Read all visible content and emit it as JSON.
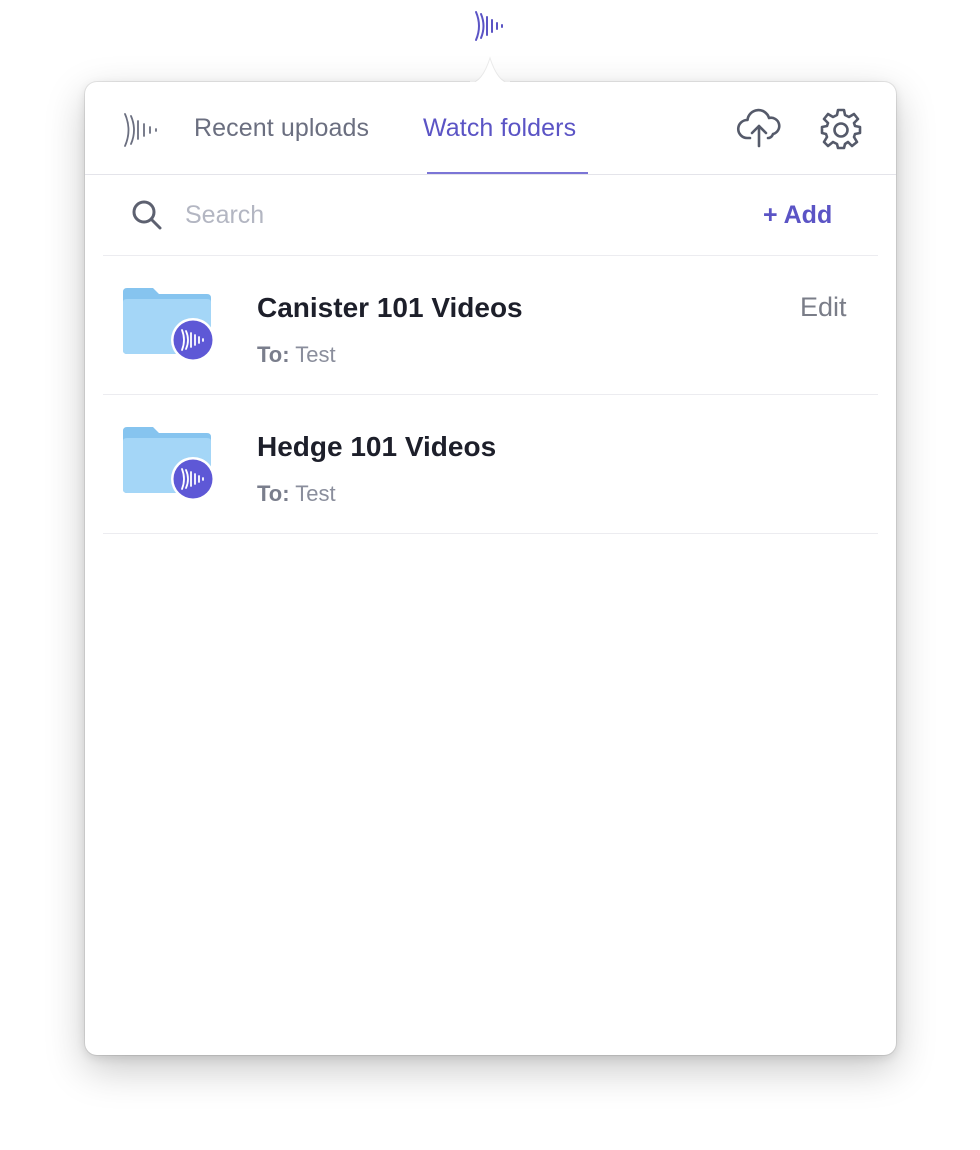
{
  "header": {
    "tabs": [
      {
        "label": "Recent uploads",
        "active": false
      },
      {
        "label": "Watch folders",
        "active": true
      }
    ],
    "icons": {
      "logo": "soundwave-logo-icon",
      "upload": "cloud-upload-icon",
      "settings": "gear-icon"
    }
  },
  "search": {
    "placeholder": "Search",
    "value": "",
    "add_label": "+ Add"
  },
  "folders": [
    {
      "name": "Canister 101 Videos",
      "dest_prefix": "To:",
      "dest": "Test",
      "edit_label": "Edit"
    },
    {
      "name": "Hedge 101 Videos",
      "dest_prefix": "To:",
      "dest": "Test"
    }
  ],
  "colors": {
    "accent": "#5b54c5",
    "folder": "#9dd2f5",
    "badge": "#5e58d6",
    "muted_text": "#6b6f80"
  }
}
